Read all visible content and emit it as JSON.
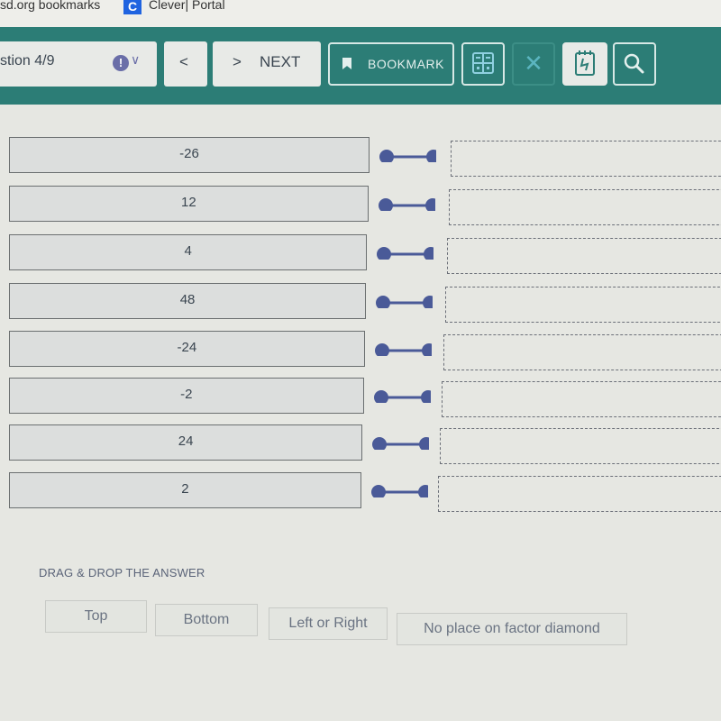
{
  "bookmarks_bar": {
    "items": [
      {
        "label": "sd.org bookmarks"
      },
      {
        "icon": "C",
        "label": "Clever| Portal"
      }
    ]
  },
  "toolbar": {
    "question_label": "stion 4/9",
    "alert_glyph": "!",
    "chevron_glyph": "∨",
    "prev_glyph": "<",
    "next_glyph": ">",
    "next_label": "NEXT",
    "bookmark_label": "BOOKMARK",
    "close_glyph": "✕"
  },
  "match_rows": [
    {
      "value": "-26"
    },
    {
      "value": "12"
    },
    {
      "value": "4"
    },
    {
      "value": "48"
    },
    {
      "value": "-24"
    },
    {
      "value": "-2"
    },
    {
      "value": "24"
    },
    {
      "value": "2"
    }
  ],
  "drag_drop": {
    "title": "DRAG & DROP THE ANSWER",
    "options": [
      "Top",
      "Bottom",
      "Left or Right",
      "No place on factor diamond"
    ]
  },
  "colors": {
    "toolbar": "#2c7d76",
    "connector": "#4a5a98"
  }
}
